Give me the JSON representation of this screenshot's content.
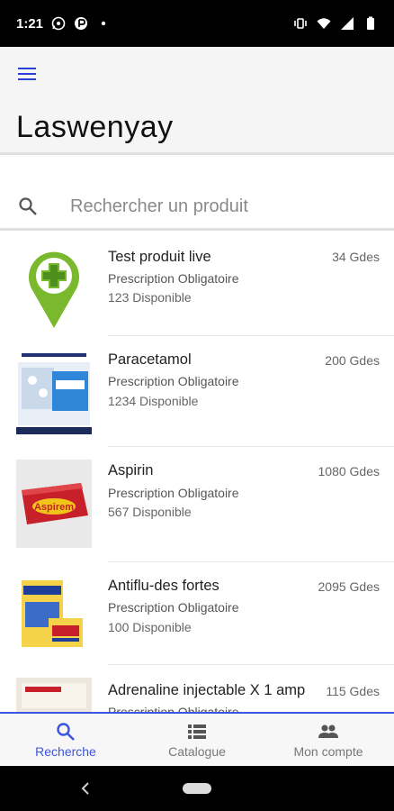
{
  "status_bar": {
    "time": "1:21",
    "icons": [
      "whatsapp-icon",
      "app-icon",
      "dot-icon",
      "vibrate-icon",
      "wifi-icon",
      "signal-icon",
      "battery-icon"
    ]
  },
  "app_bar": {
    "menu_icon": "hamburger-menu-icon",
    "title": "Laswenyay"
  },
  "search": {
    "placeholder": "Rechercher un produit",
    "value": ""
  },
  "products": [
    {
      "name": "Test produit live",
      "prescription": "Prescription Obligatoire",
      "stock": "123 Disponible",
      "price": "34 Gdes"
    },
    {
      "name": "Paracetamol",
      "prescription": "Prescription Obligatoire",
      "stock": "1234 Disponible",
      "price": "200 Gdes"
    },
    {
      "name": "Aspirin",
      "prescription": "Prescription Obligatoire",
      "stock": "567 Disponible",
      "price": "1080 Gdes",
      "brand": "Aspirem"
    },
    {
      "name": "Antiflu-des fortes",
      "prescription": "Prescription Obligatoire",
      "stock": "100 Disponible",
      "price": "2095 Gdes"
    },
    {
      "name": "Adrenaline injectable X 1 amp",
      "prescription": "Prescription Obligatoire",
      "stock": "",
      "price": "115 Gdes"
    }
  ],
  "bottom_nav": [
    {
      "label": "Recherche",
      "icon": "search-icon",
      "active": true
    },
    {
      "label": "Catalogue",
      "icon": "list-icon",
      "active": false
    },
    {
      "label": "Mon compte",
      "icon": "people-icon",
      "active": false
    }
  ],
  "colors": {
    "accent": "#3a55e0",
    "menu": "#2a3fd6",
    "status_bar": "#000000",
    "app_bar": "#f5f5f5"
  }
}
